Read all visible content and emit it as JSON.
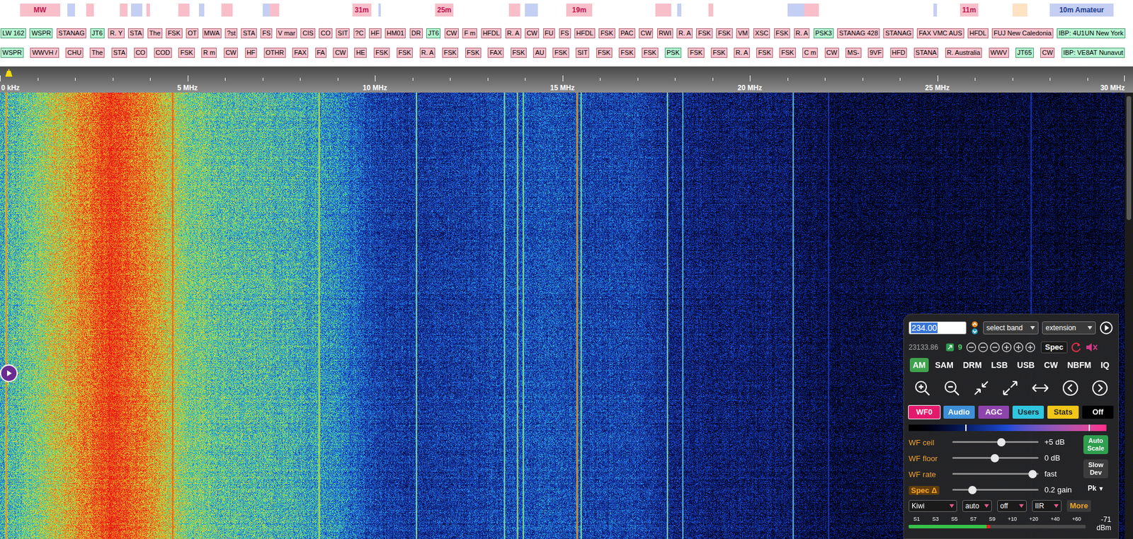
{
  "band_bar": {
    "bands": [
      {
        "label": "MW",
        "from": 0.53,
        "to": 1.6,
        "kind": "broadcast"
      },
      {
        "from": 1.8,
        "to": 2.0,
        "kind": "amateur"
      },
      {
        "from": 2.3,
        "to": 2.5,
        "kind": "broadcast"
      },
      {
        "from": 3.2,
        "to": 3.4,
        "kind": "broadcast"
      },
      {
        "from": 3.5,
        "to": 3.8,
        "kind": "amateur"
      },
      {
        "from": 3.9,
        "to": 4.0,
        "kind": "broadcast"
      },
      {
        "from": 4.75,
        "to": 5.06,
        "kind": "broadcast"
      },
      {
        "from": 5.3,
        "to": 5.45,
        "kind": "amateur"
      },
      {
        "from": 5.9,
        "to": 6.2,
        "kind": "broadcast"
      },
      {
        "from": 7.0,
        "to": 7.2,
        "kind": "amateur"
      },
      {
        "from": 7.2,
        "to": 7.45,
        "kind": "broadcast"
      },
      {
        "label": "31m",
        "from": 9.4,
        "to": 9.9,
        "kind": "broadcast"
      },
      {
        "from": 10.1,
        "to": 10.15,
        "kind": "amateur"
      },
      {
        "label": "25m",
        "from": 11.6,
        "to": 12.1,
        "kind": "broadcast"
      },
      {
        "from": 13.57,
        "to": 13.87,
        "kind": "broadcast"
      },
      {
        "from": 14.0,
        "to": 14.35,
        "kind": "amateur"
      },
      {
        "label": "19m",
        "from": 15.1,
        "to": 15.8,
        "kind": "broadcast"
      },
      {
        "from": 17.48,
        "to": 17.9,
        "kind": "broadcast"
      },
      {
        "from": 18.07,
        "to": 18.17,
        "kind": "amateur"
      },
      {
        "from": 18.9,
        "to": 19.02,
        "kind": "broadcast"
      },
      {
        "from": 21.0,
        "to": 21.45,
        "kind": "amateur"
      },
      {
        "from": 21.45,
        "to": 21.85,
        "kind": "broadcast"
      },
      {
        "from": 24.89,
        "to": 24.99,
        "kind": "amateur"
      },
      {
        "label": "11m",
        "from": 25.6,
        "to": 26.1,
        "kind": "broadcast"
      },
      {
        "from": 27.0,
        "to": 27.4,
        "kind": "cb"
      },
      {
        "label": "10m Amateur",
        "from": 28.0,
        "to": 29.7,
        "kind": "amateur"
      }
    ]
  },
  "station_rows": [
    [
      {
        "label": "LW 162",
        "kind": "digital"
      },
      {
        "label": "WSPR",
        "kind": "digital"
      },
      {
        "label": "STANAG",
        "kind": "station"
      },
      {
        "label": "JT6",
        "kind": "digital"
      },
      {
        "label": "R. Y",
        "kind": "station"
      },
      {
        "label": "STA",
        "kind": "station"
      },
      {
        "label": "The",
        "kind": "station"
      },
      {
        "label": "FSK",
        "kind": "station"
      },
      {
        "label": "OT",
        "kind": "station"
      },
      {
        "label": "MWA",
        "kind": "station"
      },
      {
        "label": "?st",
        "kind": "station"
      },
      {
        "label": "STA",
        "kind": "station"
      },
      {
        "label": "FS",
        "kind": "station"
      },
      {
        "label": "V mar",
        "kind": "station"
      },
      {
        "label": "CIS",
        "kind": "station"
      },
      {
        "label": "CO",
        "kind": "station"
      },
      {
        "label": "SIT",
        "kind": "station"
      },
      {
        "label": "?C",
        "kind": "station"
      },
      {
        "label": "HF",
        "kind": "station"
      },
      {
        "label": "HM01",
        "kind": "station"
      },
      {
        "label": "DR",
        "kind": "station"
      },
      {
        "label": "JT6",
        "kind": "digital"
      },
      {
        "label": "CW",
        "kind": "station"
      },
      {
        "label": "F m",
        "kind": "station"
      },
      {
        "label": "HFDL",
        "kind": "station"
      },
      {
        "label": "R. A",
        "kind": "station"
      },
      {
        "label": "CW",
        "kind": "station"
      },
      {
        "label": "FU",
        "kind": "station"
      },
      {
        "label": "FS",
        "kind": "station"
      },
      {
        "label": "HFDL",
        "kind": "station"
      },
      {
        "label": "FSK",
        "kind": "station"
      },
      {
        "label": "PAC",
        "kind": "station"
      },
      {
        "label": "CW",
        "kind": "station"
      },
      {
        "label": "RWI",
        "kind": "station"
      },
      {
        "label": "R. A",
        "kind": "station"
      },
      {
        "label": "FSK",
        "kind": "station"
      },
      {
        "label": "FSK",
        "kind": "station"
      },
      {
        "label": "VM",
        "kind": "station"
      },
      {
        "label": "XSC",
        "kind": "station"
      },
      {
        "label": "FSK",
        "kind": "station"
      },
      {
        "label": "R. A",
        "kind": "station"
      },
      {
        "label": "PSK3",
        "kind": "digital"
      },
      {
        "label": "STANAG 428",
        "kind": "station"
      },
      {
        "label": "STANAG",
        "kind": "station"
      },
      {
        "label": "FAX VMC AUS",
        "kind": "station"
      },
      {
        "label": "HFDL",
        "kind": "station"
      },
      {
        "label": "FUJ New Caledonia",
        "kind": "station"
      },
      {
        "label": "IBP: 4U1UN New York",
        "kind": "digital"
      }
    ],
    [
      {
        "label": "WSPR",
        "kind": "digital"
      },
      {
        "label": "WWVH /",
        "kind": "station"
      },
      {
        "label": "CHU",
        "kind": "station"
      },
      {
        "label": "The",
        "kind": "station"
      },
      {
        "label": "STA",
        "kind": "station"
      },
      {
        "label": "CO",
        "kind": "station"
      },
      {
        "label": "COD",
        "kind": "station"
      },
      {
        "label": "FSK",
        "kind": "station"
      },
      {
        "label": "R m",
        "kind": "station"
      },
      {
        "label": "CW",
        "kind": "station"
      },
      {
        "label": "HF",
        "kind": "station"
      },
      {
        "label": "OTHR",
        "kind": "station"
      },
      {
        "label": "FAX",
        "kind": "station"
      },
      {
        "label": "FA",
        "kind": "station"
      },
      {
        "label": "CW",
        "kind": "station"
      },
      {
        "label": "HE",
        "kind": "station"
      },
      {
        "label": "FSK",
        "kind": "station"
      },
      {
        "label": "FSK",
        "kind": "station"
      },
      {
        "label": "R. A",
        "kind": "station"
      },
      {
        "label": "FSK",
        "kind": "station"
      },
      {
        "label": "FSK",
        "kind": "station"
      },
      {
        "label": "FAX",
        "kind": "station"
      },
      {
        "label": "FSK",
        "kind": "station"
      },
      {
        "label": "AU",
        "kind": "station"
      },
      {
        "label": "FSK",
        "kind": "station"
      },
      {
        "label": "SIT",
        "kind": "station"
      },
      {
        "label": "FSK",
        "kind": "station"
      },
      {
        "label": "FSK",
        "kind": "station"
      },
      {
        "label": "FSK",
        "kind": "station"
      },
      {
        "label": "PSK",
        "kind": "digital"
      },
      {
        "label": "FSK",
        "kind": "station"
      },
      {
        "label": "FSK",
        "kind": "station"
      },
      {
        "label": "R. A",
        "kind": "station"
      },
      {
        "label": "FSK",
        "kind": "station"
      },
      {
        "label": "FSK",
        "kind": "station"
      },
      {
        "label": "C m",
        "kind": "station"
      },
      {
        "label": "CW",
        "kind": "station"
      },
      {
        "label": "MS-",
        "kind": "station"
      },
      {
        "label": "9VF",
        "kind": "station"
      },
      {
        "label": "HFD",
        "kind": "station"
      },
      {
        "label": "STANA",
        "kind": "station"
      },
      {
        "label": "R. Australia",
        "kind": "station"
      },
      {
        "label": "WWV",
        "kind": "station"
      },
      {
        "label": "JT65",
        "kind": "digital"
      },
      {
        "label": "CW",
        "kind": "station"
      },
      {
        "label": "IBP: VE8AT Nunavut",
        "kind": "digital"
      }
    ]
  ],
  "scale": {
    "ticks": [
      "0 kHz",
      "5 MHz",
      "10 MHz",
      "15 MHz",
      "20 MHz",
      "25 MHz",
      "30 MHz"
    ]
  },
  "waterfall": {
    "profile": [
      0.5,
      0.62,
      0.78,
      0.95,
      0.8,
      0.6,
      0.55,
      0.53,
      0.5,
      0.44,
      0.3,
      0.27,
      0.28,
      0.3,
      0.33,
      0.33,
      0.3,
      0.3,
      0.22,
      0.2,
      0.19,
      0.17,
      0.12,
      0.1,
      0.1,
      0.09,
      0.09,
      0.09,
      0.08,
      0.08,
      0.08
    ],
    "carriers": [
      {
        "mhz": 0.16,
        "strength": 0.5
      },
      {
        "mhz": 4.6,
        "strength": 0.3
      },
      {
        "mhz": 8.5,
        "strength": 0.35
      },
      {
        "mhz": 11.1,
        "strength": 0.6
      },
      {
        "mhz": 13.45,
        "strength": 0.45
      },
      {
        "mhz": 13.8,
        "strength": 0.55
      },
      {
        "mhz": 13.95,
        "strength": 0.45
      },
      {
        "mhz": 15.38,
        "strength": 1.0
      },
      {
        "mhz": 15.5,
        "strength": 0.45
      },
      {
        "mhz": 17.8,
        "strength": 0.6
      },
      {
        "mhz": 18.2,
        "strength": 0.5
      },
      {
        "mhz": 21.15,
        "strength": 0.6
      },
      {
        "mhz": 22.1,
        "strength": 0.3
      },
      {
        "mhz": 27.5,
        "strength": 0.3
      }
    ]
  },
  "control_panel": {
    "frequency": {
      "value": "234.00",
      "selected": true
    },
    "band_select": "select band",
    "extension_select": "extension",
    "readout": "23133.86",
    "zoom_level": "9",
    "spec": "Spec",
    "muted": true,
    "modes": [
      {
        "label": "AM",
        "selected": true
      },
      {
        "label": "SAM",
        "selected": false
      },
      {
        "label": "DRM",
        "selected": false
      },
      {
        "label": "LSB",
        "selected": false
      },
      {
        "label": "USB",
        "selected": false
      },
      {
        "label": "CW",
        "selected": false
      },
      {
        "label": "NBFM",
        "selected": false
      },
      {
        "label": "IQ",
        "selected": false
      }
    ],
    "tabs": [
      {
        "label": "WF0",
        "selected": true,
        "color": "#e3196c"
      },
      {
        "label": "Audio",
        "selected": false,
        "color": "#3d8fd8"
      },
      {
        "label": "AGC",
        "selected": false,
        "color": "#8e44ad"
      },
      {
        "label": "Users",
        "selected": false,
        "color": "#30c6e0"
      },
      {
        "label": "Stats",
        "selected": false,
        "color": "#f2c618"
      },
      {
        "label": "Off",
        "selected": false,
        "color": "#000000"
      }
    ],
    "sliders": [
      {
        "label": "WF ceil",
        "kind": "label",
        "level": 0.57,
        "reading": "+5 dB"
      },
      {
        "label": "WF floor",
        "kind": "label",
        "level": 0.49,
        "reading": "0 dB"
      },
      {
        "label": "WF rate",
        "kind": "label",
        "level": 0.93,
        "reading": "fast"
      },
      {
        "label": "Spec Δ",
        "kind": "button",
        "level": 0.23,
        "reading": "0.2 gain"
      }
    ],
    "auto_scale": "Auto Scale",
    "slow_dev": "Slow Dev",
    "peak": {
      "label": "Pk",
      "arrow": "▼"
    },
    "selects": [
      "Kiwi",
      "auto",
      "off",
      "IIR"
    ],
    "more": "More",
    "smeter": {
      "ticks": [
        "S1",
        "S3",
        "S5",
        "S7",
        "S9",
        "+10",
        "+20",
        "+40",
        "+60"
      ],
      "level": 0.46,
      "reading": "-71",
      "unit": "dBm"
    }
  }
}
